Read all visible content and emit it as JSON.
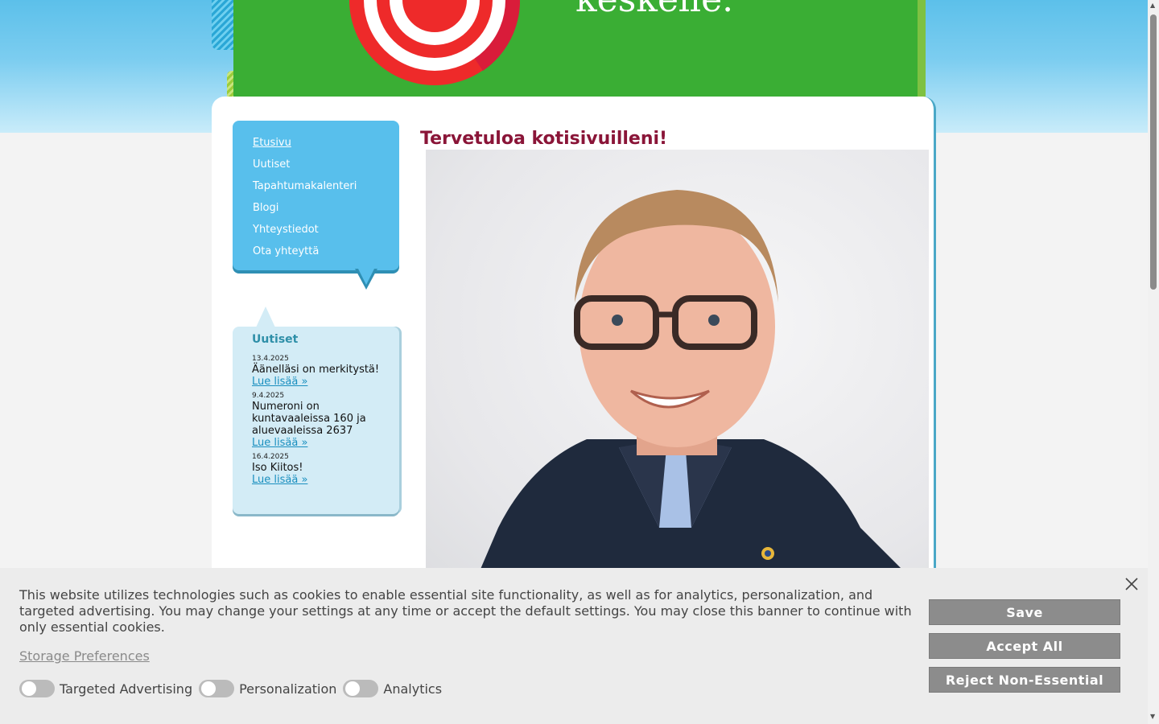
{
  "header": {
    "tagline": "keskelle."
  },
  "nav": {
    "items": [
      {
        "label": "Etusivu",
        "active": true
      },
      {
        "label": "Uutiset"
      },
      {
        "label": "Tapahtumakalenteri"
      },
      {
        "label": "Blogi"
      },
      {
        "label": "Yhteystiedot"
      },
      {
        "label": "Ota yhteyttä"
      }
    ]
  },
  "news": {
    "title": "Uutiset",
    "items": [
      {
        "date": "13.4.2025",
        "headline": "Äänelläsi on merkitystä!",
        "link": "Lue lisää »"
      },
      {
        "date": "9.4.2025",
        "headline": "Numeroni on kuntavaaleissa 160 ja aluevaaleissa 2637",
        "link": "Lue lisää »"
      },
      {
        "date": "16.4.2025",
        "headline": "Iso Kiitos!",
        "link": "Lue lisää »"
      }
    ]
  },
  "main": {
    "title": "Tervetuloa kotisivuilleni!"
  },
  "cookie": {
    "text": "This website utilizes technologies such as cookies to enable essential site functionality, as well as for analytics, personalization, and targeted advertising. You may change your settings at any time or accept the default settings. You may close this banner to continue with only essential cookies.",
    "preferences_link": "Storage Preferences",
    "toggles": [
      {
        "label": "Targeted Advertising",
        "on": false
      },
      {
        "label": "Personalization",
        "on": false
      },
      {
        "label": "Analytics",
        "on": false
      }
    ],
    "buttons": {
      "save": "Save",
      "accept_all": "Accept All",
      "reject": "Reject Non-Essential"
    }
  },
  "icons": {
    "close": "close-icon",
    "logo": "target-logo-icon"
  },
  "colors": {
    "header_green": "#3aae34",
    "nav_blue": "#58bfec",
    "title_maroon": "#8a1538",
    "button_gray": "#8c8c8c"
  }
}
